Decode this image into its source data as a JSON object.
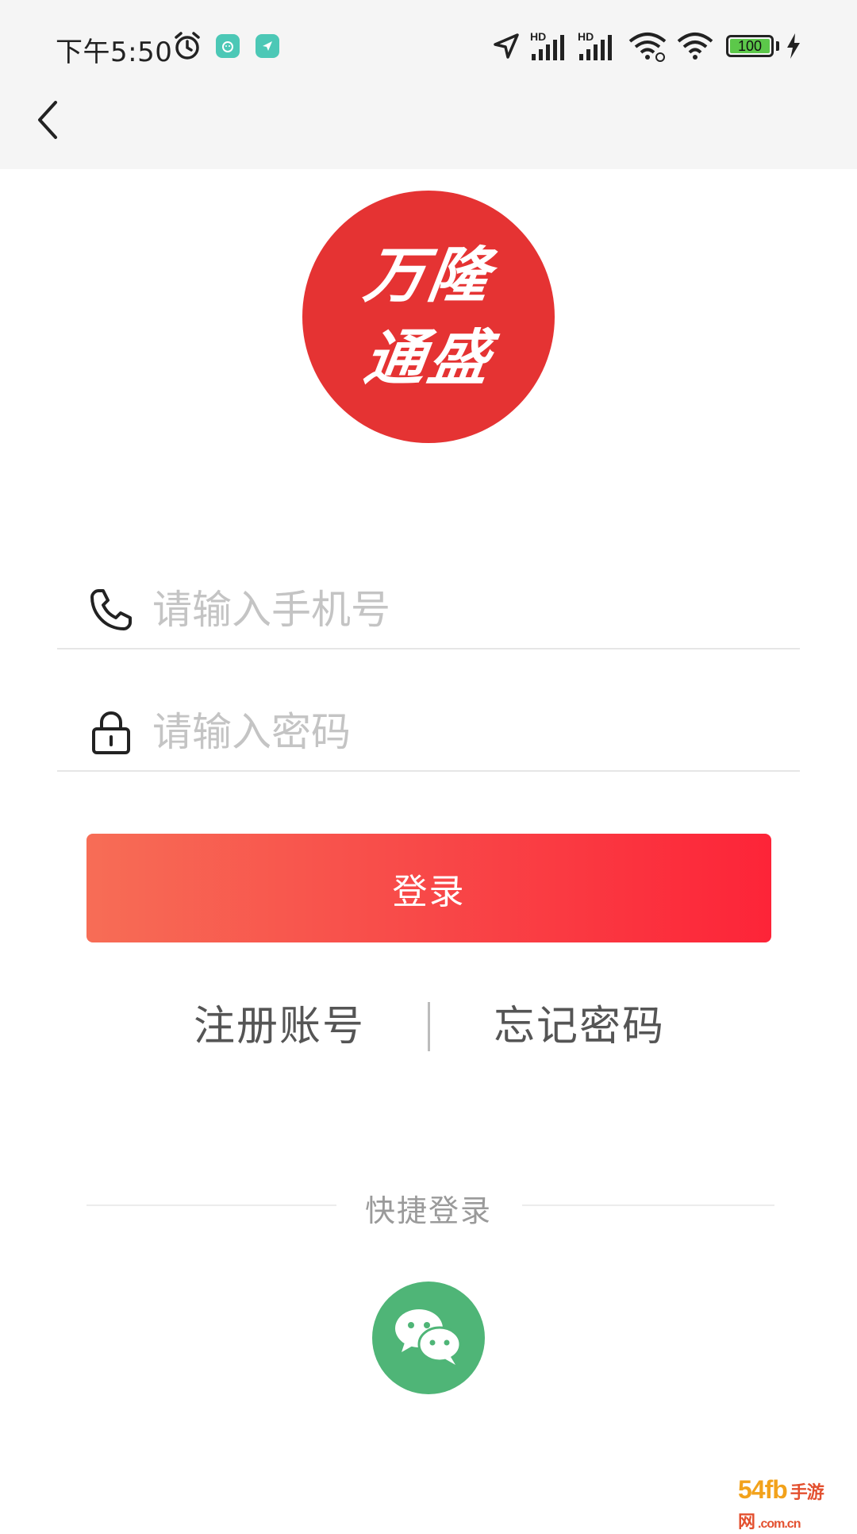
{
  "status_bar": {
    "time": "下午5:50",
    "network_label_1": "HD",
    "network_label_2": "HD",
    "battery_level": "100"
  },
  "nav": {
    "back_icon": "chevron-left-icon"
  },
  "logo": {
    "line1": "万隆",
    "line2": "通盛",
    "background_color": "#e53333"
  },
  "form": {
    "phone": {
      "icon": "phone-icon",
      "value": "",
      "placeholder": "请输入手机号"
    },
    "password": {
      "icon": "lock-icon",
      "value": "",
      "placeholder": "请输入密码"
    },
    "login_label": "登录"
  },
  "links": {
    "register": "注册账号",
    "forgot_password": "忘记密码"
  },
  "quick_login": {
    "label": "快捷登录",
    "wechat_icon": "wechat-icon",
    "wechat_color": "#4fb577"
  },
  "watermark": {
    "brand": "54fb",
    "text": "手游网",
    "domain": ".com.cn"
  }
}
